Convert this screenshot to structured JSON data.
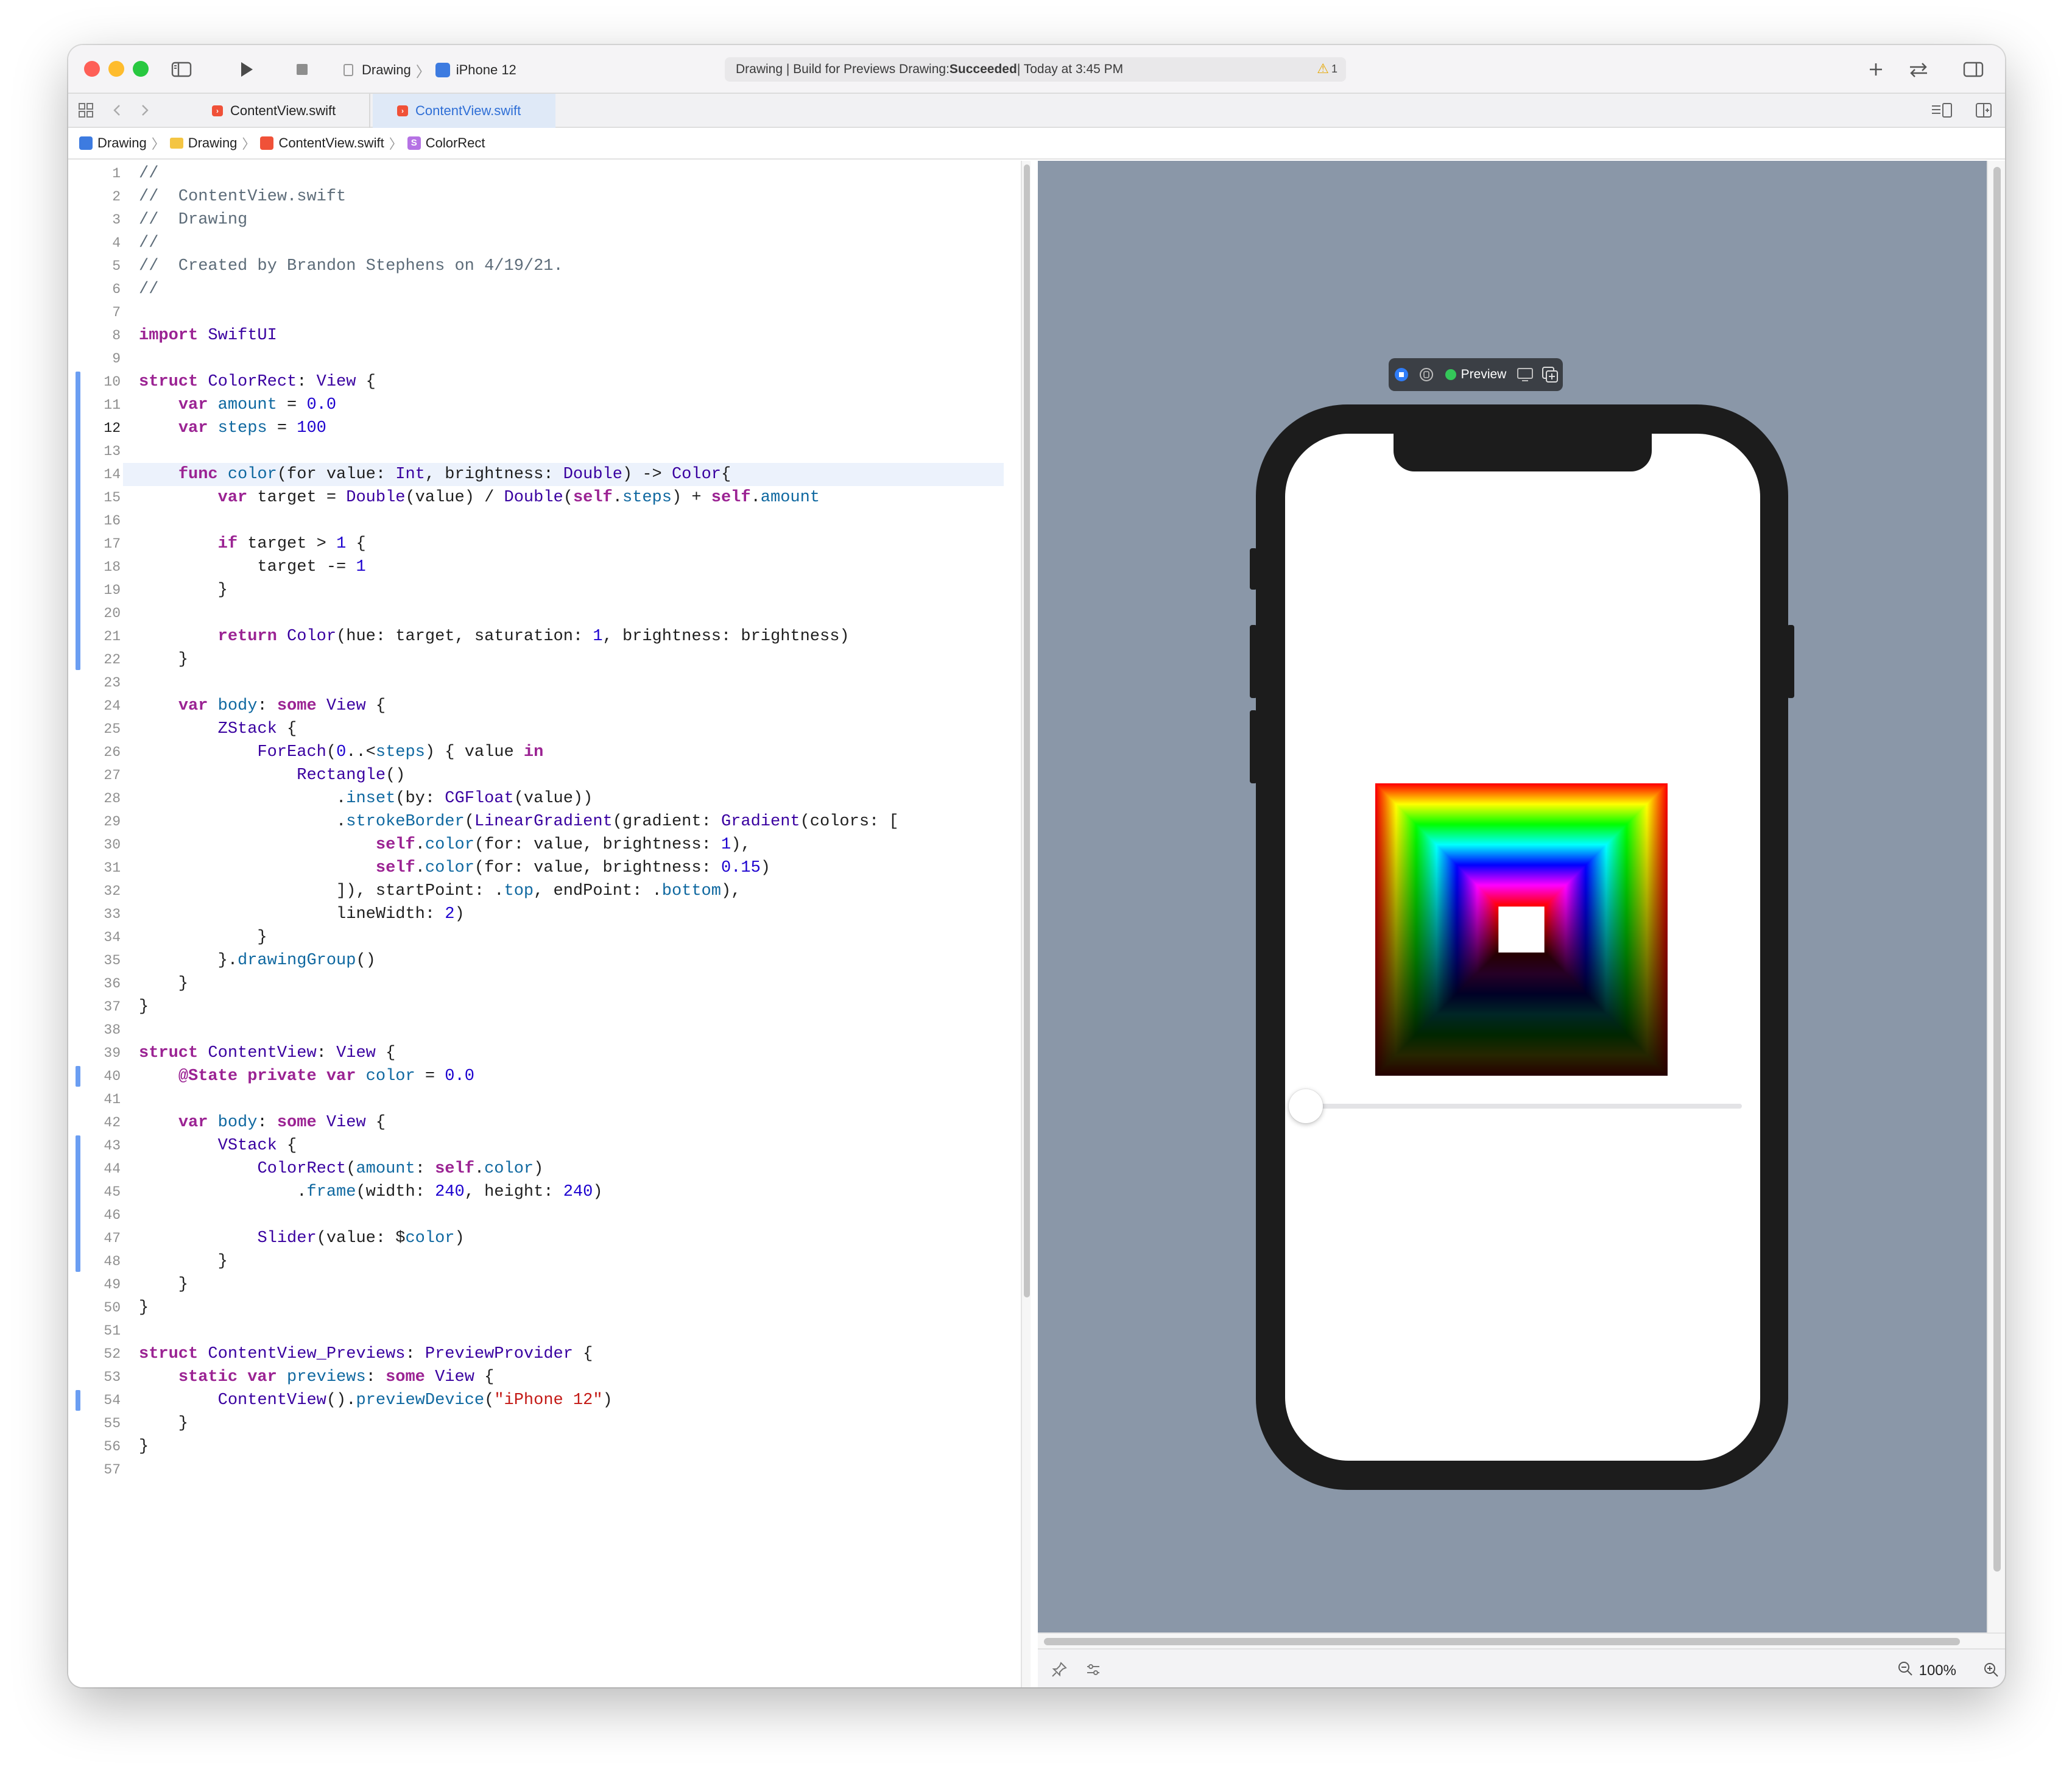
{
  "titlebar": {
    "scheme": {
      "project": "Drawing",
      "device": "iPhone 12"
    },
    "activity": {
      "prefix": "Drawing | Build for Previews Drawing: ",
      "status": "Succeeded",
      "suffix": " | Today at 3:45 PM",
      "warnings": "1"
    }
  },
  "tabs": [
    {
      "label": "ContentView.swift",
      "active": false
    },
    {
      "label": "ContentView.swift",
      "active": true
    }
  ],
  "jumpbar": [
    "Drawing",
    "Drawing",
    "ContentView.swift",
    "ColorRect"
  ],
  "editor": {
    "current_line": 12,
    "line_numbers": [
      "1",
      "2",
      "3",
      "4",
      "5",
      "6",
      "7",
      "8",
      "9",
      "10",
      "11",
      "12",
      "13",
      "14",
      "15",
      "16",
      "17",
      "18",
      "19",
      "20",
      "21",
      "22",
      "23",
      "24",
      "25",
      "26",
      "27",
      "28",
      "29",
      "30",
      "31",
      "32",
      "33",
      "34",
      "35",
      "36",
      "37",
      "38",
      "39",
      "40",
      "41",
      "42",
      "43",
      "44",
      "45",
      "46",
      "47",
      "48",
      "49",
      "50",
      "51",
      "52",
      "53",
      "54",
      "55",
      "56",
      "57"
    ],
    "lines": [
      "//",
      "//  ContentView.swift",
      "//  Drawing",
      "//",
      "//  Created by Brandon Stephens on 4/19/21.",
      "//",
      "",
      "import SwiftUI",
      "",
      "struct ColorRect: View {",
      "    var amount = 0.0",
      "    var steps = 100",
      "",
      "    func color(for value: Int, brightness: Double) -> Color{",
      "        var target = Double(value) / Double(self.steps) + self.amount",
      "",
      "        if target > 1 {",
      "            target -= 1",
      "        }",
      "",
      "        return Color(hue: target, saturation: 1, brightness: brightness)",
      "    }",
      "",
      "    var body: some View {",
      "        ZStack {",
      "            ForEach(0..<steps) { value in",
      "                Rectangle()",
      "                    .inset(by: CGFloat(value))",
      "                    .strokeBorder(LinearGradient(gradient: Gradient(colors: [",
      "                        self.color(for: value, brightness: 1),",
      "                        self.color(for: value, brightness: 0.15)",
      "                    ]), startPoint: .top, endPoint: .bottom),",
      "                    lineWidth: 2)",
      "            }",
      "        }.drawingGroup()",
      "    }",
      "}",
      "",
      "struct ContentView: View {",
      "    @State private var color = 0.0",
      "",
      "    var body: some View {",
      "        VStack {",
      "            ColorRect(amount: self.color)",
      "                .frame(width: 240, height: 240)",
      "",
      "            Slider(value: $color)",
      "        }",
      "    }",
      "}",
      "",
      "struct ContentView_Previews: PreviewProvider {",
      "    static var previews: some View {",
      "        ContentView().previewDevice(\"iPhone 12\")",
      "    }",
      "}",
      ""
    ]
  },
  "preview": {
    "label": "Preview",
    "slider_value": 0.0,
    "zoom": "100%"
  },
  "colors": {
    "accent": "#2f6fd6",
    "canvas": "#8a97a8",
    "keyword": "#9b2393",
    "type": "#3900a0",
    "number": "#1c00cf",
    "string": "#c41a16",
    "comment": "#5d6c79",
    "change_bar": "#6b9ef2"
  },
  "icons": [
    "sidebar-toggle-icon",
    "play-icon",
    "stop-icon",
    "plus-icon",
    "swap-icon",
    "inspector-icon",
    "grid-icon",
    "back-icon",
    "forward-icon",
    "swift-file-icon",
    "live-preview-icon",
    "selectable-icon",
    "device-settings-icon",
    "duplicate-icon",
    "pin-icon",
    "variants-icon",
    "zoom-out-icon",
    "zoom-in-icon",
    "warning-icon"
  ]
}
